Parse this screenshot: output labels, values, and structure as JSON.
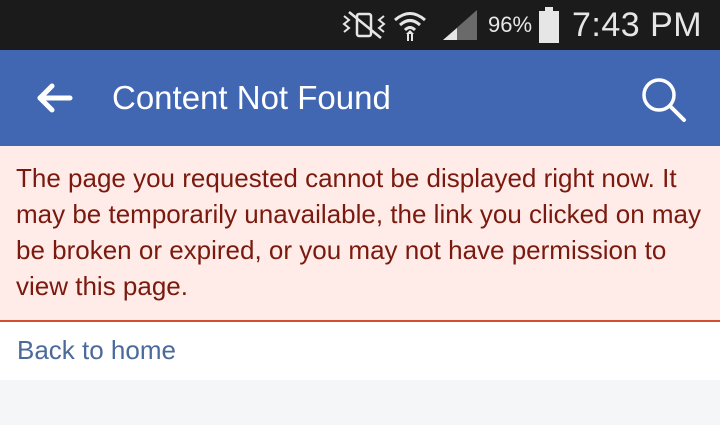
{
  "status_bar": {
    "battery_percent": "96%",
    "time": "7:43 PM",
    "icons": [
      "vibrate-mute-icon",
      "wifi-icon",
      "signal-icon",
      "battery-icon"
    ]
  },
  "app_bar": {
    "title": "Content Not Found",
    "back_icon": "back-arrow-icon",
    "search_icon": "search-icon",
    "background_color": "#4267b2"
  },
  "error": {
    "message": "The page you requested cannot be displayed right now. It may be temporarily unavailable, the link you clicked on may be broken or expired, or you may not have permission to view this page.",
    "background_color": "#ffebe8",
    "text_color": "#7a1a0e",
    "border_color": "#d1502e"
  },
  "links": {
    "back_to_home": "Back to home",
    "link_color": "#4b6a9b"
  }
}
